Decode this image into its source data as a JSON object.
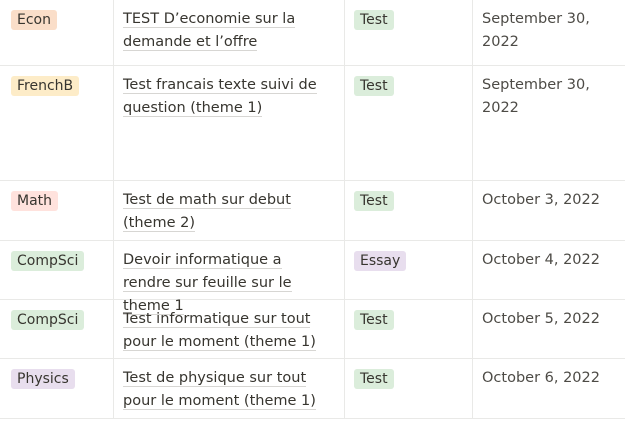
{
  "rows": [
    {
      "course": "Econ",
      "course_color": "#fadec9",
      "title": "TEST D’economie sur la demande et l’offre",
      "type": "Test",
      "type_color": "#dbeddb",
      "date": "September 30, 2022"
    },
    {
      "course": "FrenchB",
      "course_color": "#fdecc8",
      "title": "Test francais texte suivi de question (theme 1)",
      "type": "Test",
      "type_color": "#dbeddb",
      "date": "September 30, 2022"
    },
    {
      "course": "Math",
      "course_color": "#ffe2dd",
      "title": "Test de math sur debut (theme 2)",
      "type": "Test",
      "type_color": "#dbeddb",
      "date": "October 3, 2022"
    },
    {
      "course": "CompSci",
      "course_color": "#dbeddb",
      "title": "Devoir informatique a rendre sur feuille sur le theme 1",
      "type": "Essay",
      "type_color": "#e8deee",
      "date": "October 4, 2022"
    },
    {
      "course": "CompSci",
      "course_color": "#dbeddb",
      "title": "Test informatique sur tout pour le moment (theme 1)",
      "type": "Test",
      "type_color": "#dbeddb",
      "date": "October 5, 2022"
    },
    {
      "course": "Physics",
      "course_color": "#e8deee",
      "title": "Test de physique sur tout pour le moment (theme 1)",
      "type": "Test",
      "type_color": "#dbeddb",
      "date": "October 6, 2022"
    }
  ]
}
